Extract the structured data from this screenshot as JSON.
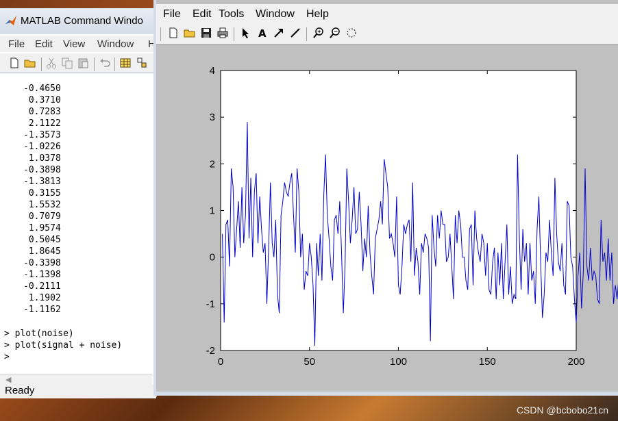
{
  "command_window": {
    "title": "MATLAB Command Windo",
    "menu": [
      "File",
      "Edit",
      "View",
      "Window",
      "H"
    ],
    "output_values": [
      "-0.4650",
      "0.3710",
      "0.7283",
      "2.1122",
      "-1.3573",
      "-1.0226",
      "1.0378",
      "-0.3898",
      "-1.3813",
      "0.3155",
      "1.5532",
      "0.7079",
      "1.9574",
      "0.5045",
      "1.8645",
      "-0.3398",
      "-1.1398",
      "-0.2111",
      "1.1902",
      "-1.1162"
    ],
    "commands": [
      "> plot(noise)",
      "> plot(signal + noise)",
      ">"
    ],
    "status": "Ready",
    "toolbar_icons": [
      "new-file-icon",
      "open-folder-icon",
      "cut-icon",
      "copy-icon",
      "paste-icon",
      "undo-icon",
      "workspace-icon",
      "guide-icon"
    ]
  },
  "figure_window": {
    "menu": [
      "File",
      "Edit",
      "Tools",
      "Window",
      "Help"
    ],
    "toolbar_icons": [
      "new-figure-icon",
      "open-icon",
      "save-icon",
      "print-icon",
      "select-arrow-icon",
      "insert-text-icon",
      "insert-arrow-icon",
      "insert-line-icon",
      "zoom-in-icon",
      "zoom-out-icon",
      "rotate-icon"
    ],
    "line_color": "#0000cc"
  },
  "chart_data": {
    "type": "line",
    "title": "",
    "xlabel": "",
    "ylabel": "",
    "xlim": [
      0,
      200
    ],
    "ylim": [
      -2,
      4
    ],
    "xticks": [
      "0",
      "50",
      "100",
      "150",
      "200"
    ],
    "yticks": [
      "-2",
      "-1",
      "0",
      "1",
      "2",
      "3",
      "4"
    ],
    "grid": false,
    "series": [
      {
        "x_start": 1,
        "x_step": 1,
        "values": [
          0.5,
          -1.4,
          0.7,
          0.8,
          -0.2,
          1.9,
          1.5,
          0.0,
          0.6,
          1.2,
          0.2,
          1.5,
          0.3,
          0.9,
          2.9,
          0.4,
          1.7,
          0.0,
          1.4,
          1.8,
          0.3,
          1.3,
          0.6,
          0.1,
          0.3,
          -1.0,
          0.2,
          1.6,
          0.3,
          0.0,
          0.8,
          -0.8,
          -1.2,
          0.9,
          1.2,
          1.6,
          1.4,
          1.3,
          1.6,
          1.8,
          0.9,
          0.1,
          1.9,
          1.4,
          0.0,
          0.5,
          -0.7,
          -0.3,
          -0.4,
          0.3,
          0.0,
          -0.6,
          -1.9,
          0.3,
          -0.4,
          0.5,
          -0.5,
          1.3,
          2.2,
          0.9,
          0.4,
          -0.2,
          -0.5,
          0.8,
          0.9,
          0.5,
          1.2,
          0.1,
          -1.2,
          -0.2,
          1.9,
          1.2,
          0.3,
          0.8,
          1.5,
          0.5,
          0.6,
          1.4,
          0.7,
          -0.3,
          0.4,
          0.0,
          1.1,
          0.1,
          -0.4,
          -0.8,
          0.4,
          0.6,
          0.8,
          1.2,
          0.7,
          2.1,
          1.8,
          1.5,
          0.4,
          0.5,
          0.3,
          0.0,
          1.3,
          -0.6,
          -0.8,
          -0.2,
          0.7,
          0.5,
          0.7,
          0.8,
          -0.1,
          1.6,
          -0.4,
          0.2,
          -0.1,
          -0.8,
          0.3,
          0.1,
          0.5,
          0.4,
          0.2,
          -1.8,
          0.9,
          0.2,
          -0.2,
          0.9,
          0.4,
          1.0,
          0.7,
          0.7,
          -0.1,
          0.0,
          0.5,
          -0.2,
          -0.9,
          0.9,
          0.3,
          1.0,
          0.7,
          0.0,
          0.0,
          -0.5,
          -0.7,
          0.6,
          0.7,
          -0.6,
          1.0,
          0.4,
          0.1,
          -0.1,
          0.5,
          0.3,
          -0.4,
          0.3,
          -0.7,
          -0.8,
          -0.1,
          0.2,
          -0.9,
          0.1,
          -0.6,
          0.3,
          -0.9,
          -0.1,
          0.7,
          -0.8,
          -0.2,
          -1.0,
          -0.8,
          -0.9,
          2.2,
          0.4,
          -0.7,
          0.6,
          -0.1,
          0.3,
          -0.8,
          0.3,
          -0.5,
          -0.3,
          -1.0,
          0.6,
          1.3,
          -0.1,
          -1.3,
          -0.8,
          0.1,
          -0.1,
          0.8,
          0.1,
          -0.4,
          1.7,
          0.5,
          -0.1,
          -0.3,
          0.3,
          -0.6,
          -0.8,
          1.2,
          1.1,
          0.0,
          -0.2,
          -0.9,
          -1.4,
          -0.4,
          0.1,
          -1.1,
          -0.3,
          1.9,
          -0.2,
          -0.5,
          0.2,
          -0.5,
          -0.3,
          -0.4,
          -0.9,
          -1.0,
          0.8,
          -0.1,
          0.1,
          -0.5,
          0.4,
          -0.5,
          0.1,
          -1.0,
          -0.6,
          -0.9,
          -0.4,
          0.0,
          -1.5,
          -0.6,
          -0.2,
          -0.3,
          -0.7,
          0.3,
          0.0,
          1.8,
          0.2,
          -0.2,
          0.4,
          -0.2,
          0.6,
          -0.5,
          -0.3,
          0.9,
          0.1,
          -0.2,
          -0.5,
          1.2,
          -1.0,
          -0.9,
          0.1,
          -0.1,
          -0.3,
          0.8,
          1.1,
          0.4,
          3.0,
          1.0,
          -0.8,
          0.1,
          -0.6,
          0.0,
          0.9,
          -0.4,
          -0.6,
          1.4,
          1.8,
          -0.2,
          0.6,
          1.8,
          1.1,
          0.8,
          2.5,
          0.9,
          -0.3,
          -0.1,
          0.2,
          1.0,
          0.0,
          1.4,
          -0.2,
          0.2
        ]
      }
    ]
  },
  "watermark": "CSDN @bcbobo21cn"
}
